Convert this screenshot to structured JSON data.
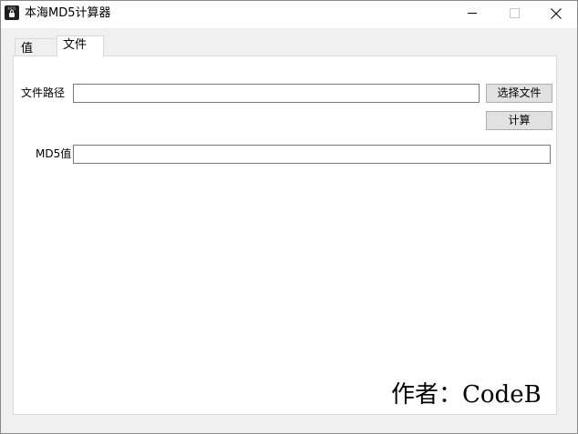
{
  "window": {
    "title": "本海MD5计算器",
    "icon_name": "md5-app-icon",
    "icon_text": "MD5",
    "controls": {
      "minimize_icon": "minimize-icon",
      "maximize_icon": "maximize-icon",
      "close_icon": "close-icon"
    }
  },
  "tabs": [
    {
      "label": "值",
      "selected": false
    },
    {
      "label": "文件",
      "selected": true
    }
  ],
  "file_tab": {
    "path_label": "文件路径",
    "path_value": "",
    "choose_button_label": "选择文件",
    "calc_button_label": "计算",
    "md5_label": "MD5值",
    "md5_value": ""
  },
  "author": "作者：CodeB",
  "colors": {
    "window_background": "#f0f0f0",
    "titlebar_background": "#ffffff",
    "panel_background": "#ffffff",
    "button_background": "#e1e1e1",
    "button_border": "#adadad",
    "input_border": "#7a7a7a"
  }
}
